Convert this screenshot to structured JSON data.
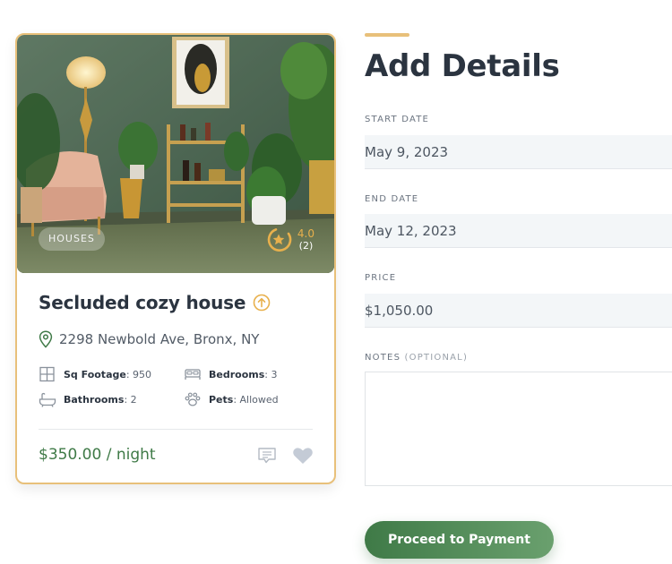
{
  "listing": {
    "category": "HOUSES",
    "rating": "4.0",
    "review_count": "(2)",
    "title": "Secluded cozy house",
    "address": "2298 Newbold Ave, Bronx, NY",
    "features": {
      "sq_footage_label": "Sq Footage",
      "sq_footage_value": ": 950",
      "bedrooms_label": "Bedrooms",
      "bedrooms_value": ": 3",
      "bathrooms_label": "Bathrooms",
      "bathrooms_value": ": 2",
      "pets_label": "Pets",
      "pets_value": ": Allowed"
    },
    "price": "$350.00 / night",
    "icons": [
      "trending-up-icon",
      "map-pin-icon",
      "sq-footage-icon",
      "bed-icon",
      "bathtub-icon",
      "paw-icon",
      "comment-icon",
      "heart-icon",
      "star-ring-icon"
    ]
  },
  "form": {
    "title": "Add Details",
    "start_date_label": "START DATE",
    "start_date_value": "May 9, 2023",
    "end_date_label": "END DATE",
    "end_date_value": "May 12, 2023",
    "price_label": "PRICE",
    "price_value": "$1,050.00",
    "notes_label": "NOTES",
    "notes_optional": "(OPTIONAL)",
    "notes_value": "",
    "submit_label": "Proceed to Payment"
  },
  "colors": {
    "accent_gold": "#e8c07a",
    "brand_green": "#3f7a47",
    "rating_gold": "#e8b04c",
    "text_dark": "#2b3440",
    "input_bg": "#f3f6f8"
  }
}
